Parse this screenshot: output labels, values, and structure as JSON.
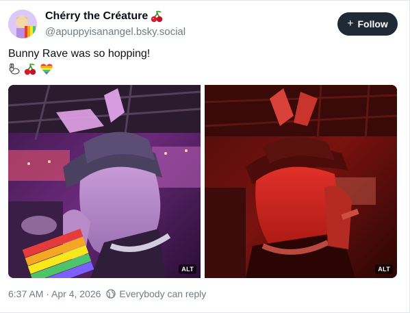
{
  "author": {
    "display_name": "Chérry the Créature",
    "handle": "@apuppyisanangel.bsky.social",
    "avatar_icon": "rainbow-avatar-icon",
    "name_emoji": "cherries-icon"
  },
  "follow_button": {
    "label": "Follow",
    "icon": "plus-icon"
  },
  "post": {
    "text": "Bunny Rave was so hopping!",
    "emojis": [
      "rabbit-icon",
      "cherries-icon",
      "rainbow-heart-icon"
    ]
  },
  "media": [
    {
      "alt_badge": "ALT",
      "tone": "purple"
    },
    {
      "alt_badge": "ALT",
      "tone": "red"
    }
  ],
  "footer": {
    "timestamp": "6:37 AM · Apr 4, 2026",
    "reply_setting": "Everybody can reply",
    "reply_icon": "earth-icon"
  },
  "colors": {
    "button_bg": "#1f2a36",
    "muted_text": "#6f7b86",
    "text": "#0b0f14"
  }
}
